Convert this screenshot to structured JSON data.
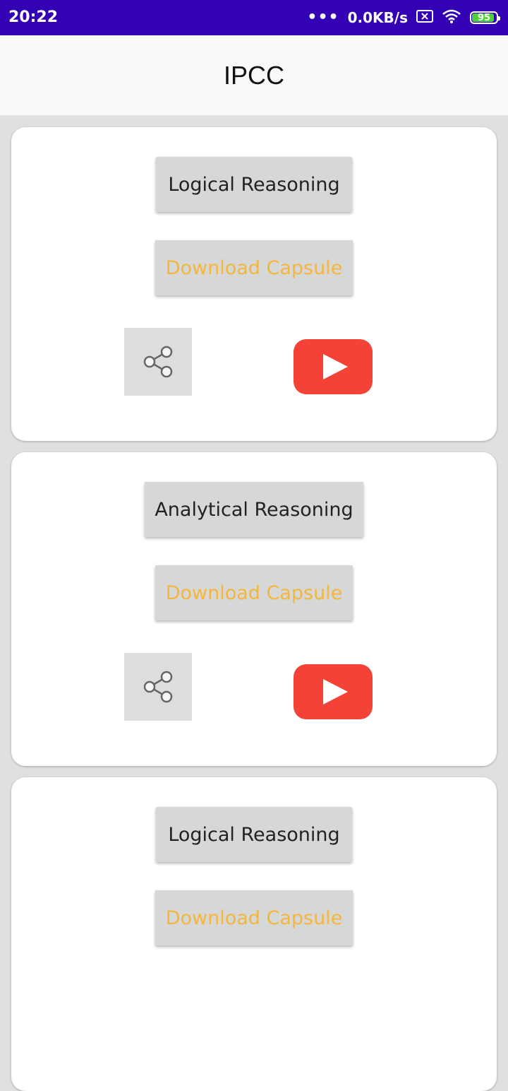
{
  "status_bar": {
    "time": "20:22",
    "dots": "•••",
    "network_speed": "0.0KB/s",
    "battery": "95"
  },
  "app_bar": {
    "title": "IPCC"
  },
  "cards": [
    {
      "title": "Logical Reasoning",
      "download_label": "Download Capsule"
    },
    {
      "title": "Analytical Reasoning",
      "download_label": "Download Capsule"
    },
    {
      "title": "Logical Reasoning",
      "download_label": "Download Capsule"
    }
  ],
  "colors": {
    "status_bar": "#3300b3",
    "download_text": "#f4b63c",
    "youtube_red": "#f44336"
  }
}
